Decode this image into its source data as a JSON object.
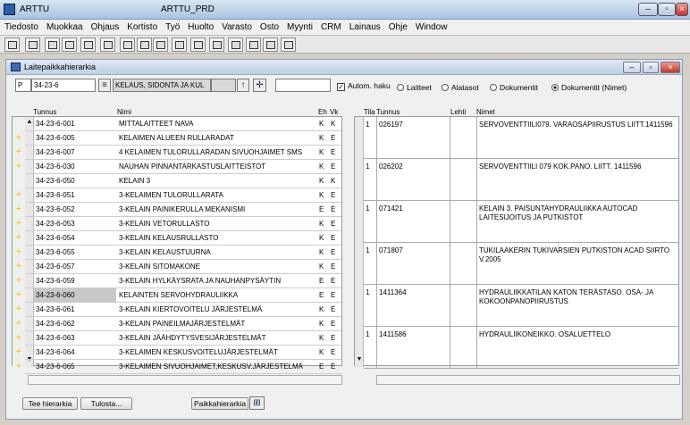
{
  "window": {
    "title": "ARTTU",
    "subtitle": "ARTTU_PRD"
  },
  "menu": [
    "Tiedosto",
    "Muokkaa",
    "Ohjaus",
    "Kortisto",
    "Työ",
    "Huolto",
    "Varasto",
    "Osto",
    "Myynti",
    "CRM",
    "Lainaus",
    "Ohje",
    "Window"
  ],
  "child": {
    "title": "Laitepaikkahierarkia"
  },
  "filter": {
    "prefix": "P",
    "code": "34-23-6",
    "description": "KELAUS, SIDONTA JA KUL",
    "auto_label": "Autom. haku",
    "options": [
      "Laitteet",
      "Alatasot",
      "Dokumentit",
      "Dokumentit (Nimet)"
    ],
    "selected": 3
  },
  "left_headers": {
    "code": "Tunnus",
    "name": "Nimi",
    "eh": "Eh",
    "vk": "Vk"
  },
  "left_rows": [
    {
      "m": "",
      "code": "34-23-6-001",
      "name": "MITTALAITTEET NAVA",
      "eh": "K",
      "vk": "K"
    },
    {
      "m": "+",
      "code": "34-23-6-005",
      "name": "KELAIMEN ALUEEN RULLARADAT",
      "eh": "K",
      "vk": "E"
    },
    {
      "m": "+",
      "code": "34-23-6-007",
      "name": "4 KELAIMEN TULORULLARADAN SIVUOHJAIMET SMS",
      "eh": "K",
      "vk": "E"
    },
    {
      "m": "+",
      "code": "34-23-6-030",
      "name": "NAUHAN PINNANTARKASTUSLAITTEISTOT",
      "eh": "K",
      "vk": "E"
    },
    {
      "m": "",
      "code": "34-23-6-050",
      "name": "KELAIN 3",
      "eh": "K",
      "vk": "K"
    },
    {
      "m": "+",
      "code": "34-23-6-051",
      "name": "3-KELAIMEN TULORULLARATA",
      "eh": "K",
      "vk": "E"
    },
    {
      "m": "+",
      "code": "34-23-6-052",
      "name": "3-KELAIN PAINIKERULLA MEKANISMI",
      "eh": "E",
      "vk": "E"
    },
    {
      "m": "+",
      "code": "34-23-6-053",
      "name": "3-KELAIN VETORULLASTO",
      "eh": "K",
      "vk": "E"
    },
    {
      "m": "+",
      "code": "34-23-6-054",
      "name": "3-KELAIN KELAUSRULLASTO",
      "eh": "K",
      "vk": "E"
    },
    {
      "m": "+",
      "code": "34-23-6-055",
      "name": "3-KELAIN  KELAUSTUURNA",
      "eh": "K",
      "vk": "E"
    },
    {
      "m": "+",
      "code": "34-23-6-057",
      "name": "3-KELAIN SITOMAKONE",
      "eh": "K",
      "vk": "E"
    },
    {
      "m": "+",
      "code": "34-23-6-059",
      "name": "3-KELAIN HYLKÄYSRATA JA NAUHANPYSÄYTIN",
      "eh": "E",
      "vk": "E"
    },
    {
      "m": "+",
      "code": "34-23-6-060",
      "name": "KELAINTEN SERVOHYDRAULIIKKA",
      "eh": "E",
      "vk": "E",
      "sel": true
    },
    {
      "m": "+",
      "code": "34-23-6-061",
      "name": "3-KELAIN KIERTOVOITELU JÄRJESTELMÄ",
      "eh": "K",
      "vk": "E"
    },
    {
      "m": "+",
      "code": "34-23-6-062",
      "name": "3-KELAIN PAINEILMAJÄRJESTELMÄT",
      "eh": "K",
      "vk": "E"
    },
    {
      "m": "+",
      "code": "34-23-6-063",
      "name": "3-KELAIN JÄÄHDYTYSVESIJÄRJESTELMÄT",
      "eh": "K",
      "vk": "E"
    },
    {
      "m": "+",
      "code": "34-23-6-064",
      "name": "3-KELAIMEN KESKUSVOITELUJÄRJESTELMÄT",
      "eh": "K",
      "vk": "E"
    },
    {
      "m": "+",
      "code": "34-23-6-065",
      "name": "3-KELAIMEN SIVUOHJAIMET,KESKUSV.JÄRJESTELMÄ",
      "eh": "E",
      "vk": "E"
    }
  ],
  "right_headers": {
    "tila": "Tila",
    "code": "Tunnus",
    "lehti": "Lehti",
    "names": "Nimet"
  },
  "right_rows": [
    {
      "t": "1",
      "code": "026197",
      "lehti": "",
      "name": "SERVOVENTTIILI079. VARAOSAPIIRUSTUS LIITT.1411596"
    },
    {
      "t": "1",
      "code": "026202",
      "lehti": "",
      "name": "SERVOVENTTIILI 079 KOK.PANO. LIITT. 1411596"
    },
    {
      "t": "1",
      "code": "071421",
      "lehti": "",
      "name": "KELAIN 3. PAISUNTAHYDRAULIIKKA        AUTOCAD LAITESIJOITUS JA PUTKISTOT"
    },
    {
      "t": "1",
      "code": "071807",
      "lehti": "",
      "name": "TUKILAAKERIN TUKIVARSIEN PUTKISTON      ACAD SIIRTO V.2005"
    },
    {
      "t": "1",
      "code": "1411364",
      "lehti": "",
      "name": "HYDRAULIIKKATILAN KATON TERÄSTASO. OSA- JA KOKOONPANOPIIRUSTUS"
    },
    {
      "t": "1",
      "code": "1411586",
      "lehti": "",
      "name": "HYDRAULIIKONEIKKO. OSALUETTELO"
    }
  ],
  "buttons": {
    "hierarchy": "Tee hierarkia",
    "print": "Tulosta...",
    "place": "Paikkahierarkia"
  }
}
